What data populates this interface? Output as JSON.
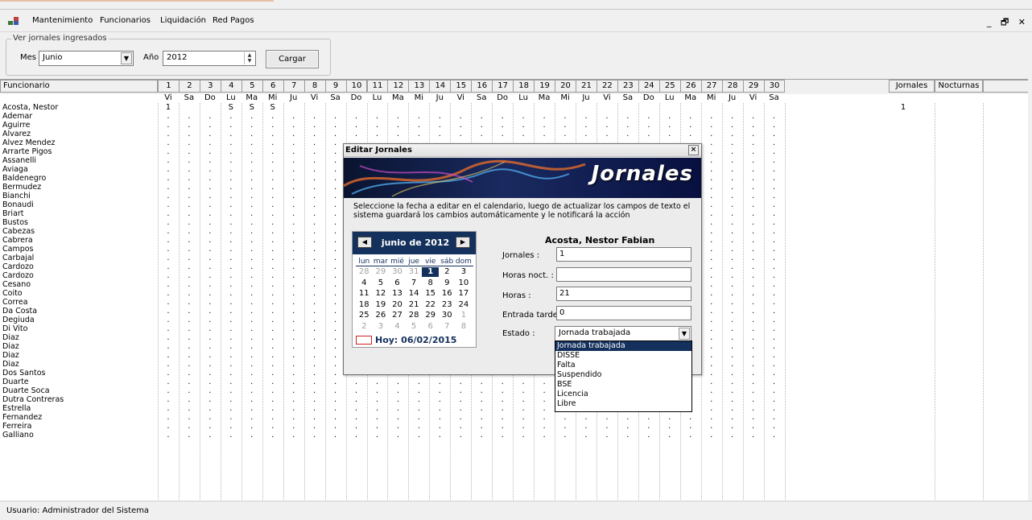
{
  "menu": {
    "items": [
      "Mantenimiento",
      "Funcionarios",
      "Liquidación",
      "Red Pagos"
    ],
    "window_controls": "_ 🗗 ✕"
  },
  "filter": {
    "group_title": "Ver jornales ingresados",
    "mes_label": "Mes",
    "mes_value": "Junio",
    "anio_label": "Año",
    "anio_value": "2012",
    "load_button": "Cargar"
  },
  "grid": {
    "header_funcionario": "Funcionario",
    "days": [
      "1",
      "2",
      "3",
      "4",
      "5",
      "6",
      "7",
      "8",
      "9",
      "10",
      "11",
      "12",
      "13",
      "14",
      "15",
      "16",
      "17",
      "18",
      "19",
      "20",
      "21",
      "22",
      "23",
      "24",
      "25",
      "26",
      "27",
      "28",
      "29",
      "30"
    ],
    "weekdays": [
      "Vi",
      "Sa",
      "Do",
      "Lu",
      "Ma",
      "Mi",
      "Ju",
      "Vi",
      "Sa",
      "Do",
      "Lu",
      "Ma",
      "Mi",
      "Ju",
      "Vi",
      "Sa",
      "Do",
      "Lu",
      "Ma",
      "Mi",
      "Ju",
      "Vi",
      "Sa",
      "Do",
      "Lu",
      "Ma",
      "Mi",
      "Ju",
      "Vi",
      "Sa"
    ],
    "header_jornales": "Jornales",
    "header_nocturnas": "Nocturnas",
    "first_row": {
      "name": "Acosta, Nestor",
      "values": [
        "1",
        "",
        "",
        "S",
        "S",
        "S",
        "",
        "",
        "",
        "",
        "",
        "",
        "",
        "",
        "",
        "",
        "",
        "",
        "",
        "",
        "",
        "",
        "",
        "",
        "",
        "",
        "",
        "",
        "",
        ""
      ],
      "jornales": "1",
      "nocturnas": ""
    },
    "names": [
      "Ademar",
      "Aguirre",
      "Alvarez",
      "Alvez Mendez",
      "Arrarte Pigos",
      "Assanelli",
      "Aviaga",
      "Baldenegro",
      "Bermudez",
      "Bianchi",
      "Bonaudi",
      "Briart",
      "Bustos",
      "Cabezas",
      "Cabrera",
      "Campos",
      "Carbajal",
      "Cardozo",
      "Cardozo",
      "Cesano",
      "Coito",
      "Correa",
      "Da Costa",
      "Degiuda",
      "Di Vito",
      "Diaz",
      "Diaz",
      "Diaz",
      "Diaz",
      "Dos Santos",
      "Duarte",
      "Duarte Soca",
      "Dutra Contreras",
      "Estrella",
      "Fernandez",
      "Ferreira",
      "Galliano"
    ],
    "empty_mark": "."
  },
  "status": {
    "text": "Usuario: Administrador del Sistema"
  },
  "dialog": {
    "title": "Editar Jornales",
    "close_label": "×",
    "banner_text": "Jornales",
    "message": "Seleccione la fecha a editar en el calendario, luego de actualizar los campos de texto el sistema guardará los cambios automáticamente y le notificará la acción",
    "employee": "Acosta, Nestor Fabian",
    "calendar": {
      "title": "junio de 2012",
      "prev": "◀",
      "next": "▶",
      "weekdays": [
        "lun",
        "mar",
        "mié",
        "jue",
        "vie",
        "sáb",
        "dom"
      ],
      "weeks": [
        [
          "28",
          "29",
          "30",
          "31",
          "1",
          "2",
          "3"
        ],
        [
          "4",
          "5",
          "6",
          "7",
          "8",
          "9",
          "10"
        ],
        [
          "11",
          "12",
          "13",
          "14",
          "15",
          "16",
          "17"
        ],
        [
          "18",
          "19",
          "20",
          "21",
          "22",
          "23",
          "24"
        ],
        [
          "25",
          "26",
          "27",
          "28",
          "29",
          "30",
          "1"
        ],
        [
          "2",
          "3",
          "4",
          "5",
          "6",
          "7",
          "8"
        ]
      ],
      "selected_day": "1",
      "today_label": "Hoy: 06/02/2015"
    },
    "fields": {
      "jornales_label": "Jornales :",
      "jornales_value": "1",
      "horas_noct_label": "Horas noct. :",
      "horas_noct_value": "",
      "horas_label": "Horas :",
      "horas_value": "21",
      "entrada_tarde_label": "Entrada tarde:",
      "entrada_tarde_value": "0",
      "estado_label": "Estado :",
      "estado_value": "Jornada trabajada"
    },
    "estado_options": [
      "Jornada trabajada",
      "DISSE",
      "Falta",
      "Suspendido",
      "BSE",
      "Licencia",
      "Libre"
    ]
  }
}
